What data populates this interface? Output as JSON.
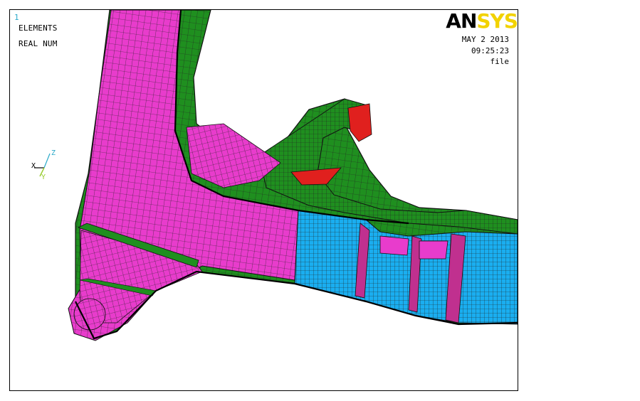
{
  "window": {
    "number": "1"
  },
  "legend": {
    "line1": "ELEMENTS",
    "line2": "REAL NUM"
  },
  "logo": {
    "part1": "AN",
    "part2": "SYS"
  },
  "stamp": {
    "date": "MAY  2 2013",
    "time": "09:25:23",
    "title": "file"
  },
  "triad": {
    "x": "X",
    "z": "Z",
    "y": "Y"
  },
  "colors": {
    "magenta": "#e83ccc",
    "green": "#1f8f1f",
    "cyan": "#1aaef0",
    "red": "#e0201e",
    "mesh": "#222222",
    "logo_yellow": "#f2d200",
    "window_number": "#2aa9c9"
  }
}
